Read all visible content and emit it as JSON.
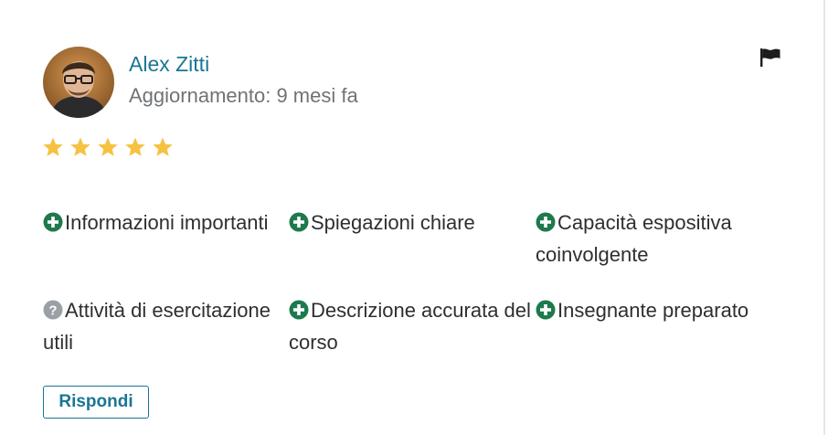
{
  "review": {
    "author": "Alex Zitti",
    "updated_label": "Aggiornamento:",
    "updated_value": "9 mesi fa",
    "rating": 5,
    "rating_max": 5,
    "star_color": "#f5c242",
    "flag_icon": "flag-icon",
    "tags": [
      {
        "label": "Informazioni importanti",
        "icon": "plus-circle-icon",
        "color": "#1e7a4c"
      },
      {
        "label": "Spiegazioni chiare",
        "icon": "plus-circle-icon",
        "color": "#1e7a4c"
      },
      {
        "label": "Capacità espositiva coinvolgente",
        "icon": "plus-circle-icon",
        "color": "#1e7a4c"
      },
      {
        "label": "Attività di esercitazione utili",
        "icon": "question-circle-icon",
        "color": "#9aa0a6"
      },
      {
        "label": "Descrizione accurata del corso",
        "icon": "plus-circle-icon",
        "color": "#1e7a4c"
      },
      {
        "label": "Insegnante preparato",
        "icon": "plus-circle-icon",
        "color": "#1e7a4c"
      }
    ],
    "reply_label": "Rispondi",
    "accent_color": "#1a7694"
  }
}
